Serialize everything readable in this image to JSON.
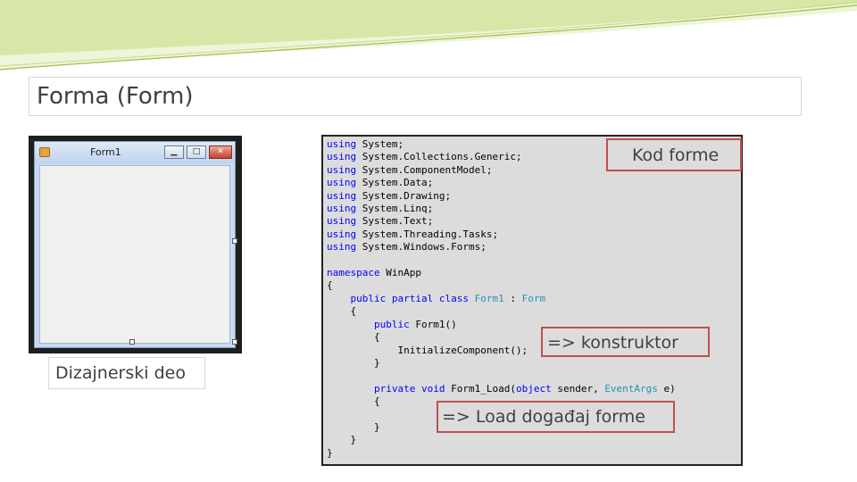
{
  "slide": {
    "title": "Forma (Form)",
    "designer_caption": "Dizajnerski deo",
    "callout_code": "Kod forme",
    "callout_constructor": "=> konstruktor",
    "callout_load": "=> Load događaj forme"
  },
  "designer": {
    "form_title": "Form1",
    "minimize_icon": "minimize-icon",
    "maximize_icon": "maximize-icon",
    "close_icon": "close-icon",
    "close_glyph": "✕"
  },
  "code": {
    "using_lines": [
      "System;",
      "System.Collections.Generic;",
      "System.ComponentModel;",
      "System.Data;",
      "System.Drawing;",
      "System.Linq;",
      "System.Text;",
      "System.Threading.Tasks;",
      "System.Windows.Forms;"
    ],
    "kw_using": "using",
    "kw_namespace": "namespace",
    "namespace_name": "WinApp",
    "open_brace": "{",
    "close_brace": "}",
    "kw_public": "public",
    "kw_partial": "partial",
    "kw_class": "class",
    "class_name": "Form1",
    "base_separator": ":",
    "base_class": "Form",
    "constructor_sig": "Form1()",
    "init_call": "InitializeComponent();",
    "kw_private": "private",
    "kw_void": "void",
    "load_method": "Form1_Load(",
    "kw_object": "object",
    "param_sender": "sender,",
    "type_eventargs": "EventArgs",
    "param_e": "e)"
  }
}
